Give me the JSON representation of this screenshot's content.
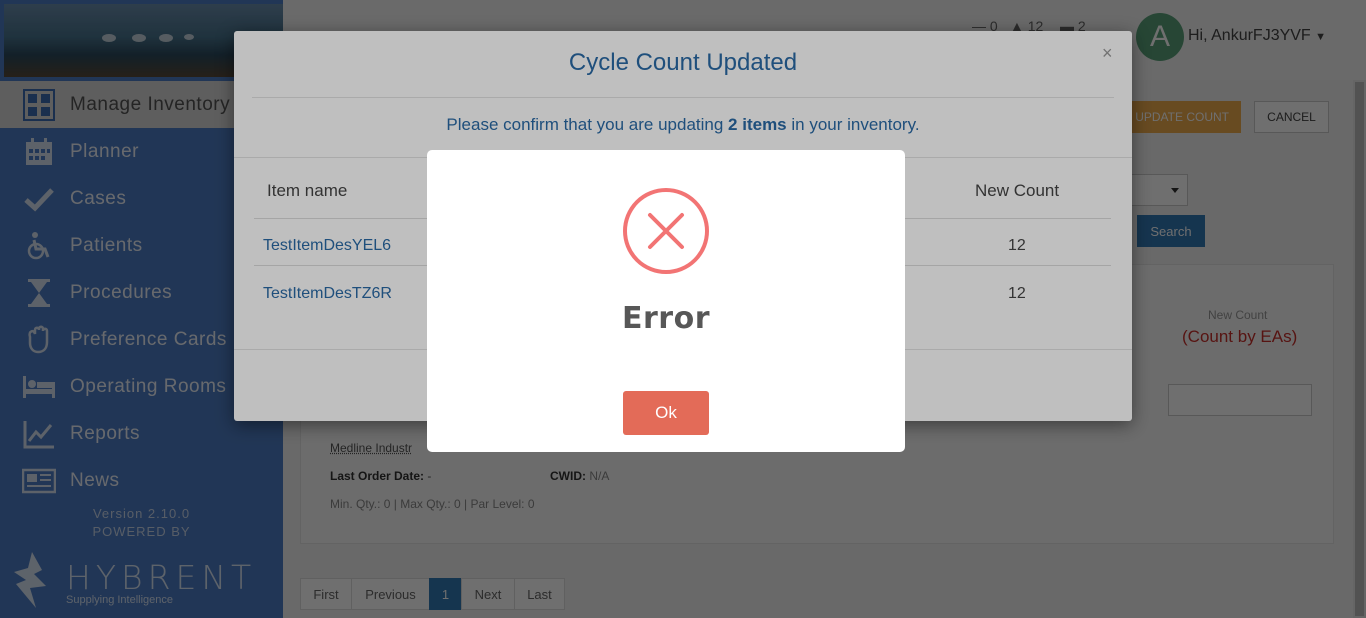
{
  "header": {
    "stat_1": "0",
    "stat_2": "12",
    "stat_3": "2",
    "avatar_letter": "A",
    "greeting": "Hi, AnkurFJ3YVF"
  },
  "sidebar": {
    "active_item": "Manage Inventory",
    "items": [
      {
        "label": "Planner",
        "icon": "calendar-icon"
      },
      {
        "label": "Cases",
        "icon": "checkmark-icon"
      },
      {
        "label": "Patients",
        "icon": "wheelchair-icon"
      },
      {
        "label": "Procedures",
        "icon": "hourglass-icon"
      },
      {
        "label": "Preference Cards",
        "icon": "glove-icon"
      },
      {
        "label": "Operating Rooms",
        "icon": "bed-icon"
      },
      {
        "label": "Reports",
        "icon": "line-chart-icon"
      },
      {
        "label": "News",
        "icon": "newspaper-icon"
      }
    ],
    "version": "Version 2.10.0",
    "powered_by": "POWERED BY",
    "brand": "HYBRENT",
    "tagline": "Supplying Intelligence"
  },
  "page": {
    "update_count_button": "UPDATE COUNT",
    "cancel_button": "CANCEL",
    "search_button": "Search",
    "new_count_header": "New Count",
    "count_by": "(Count by EAs)",
    "vendor": "Medline Industr",
    "last_order_label": "Last Order Date:",
    "last_order_value": "-",
    "cwid_label": "CWID:",
    "cwid_value": "N/A",
    "qty_info": "Min. Qty.: 0 | Max Qty.: 0 | Par Level: 0",
    "pagination": [
      "First",
      "Previous",
      "1",
      "Next",
      "Last"
    ]
  },
  "modal": {
    "title": "Cycle Count Updated",
    "confirm_prefix": "Please confirm that you are updating ",
    "confirm_bold": "2 items",
    "confirm_suffix": " in your inventory.",
    "col_item": "Item name",
    "col_new_count": "New Count",
    "rows": [
      {
        "item": "TestItemDesYEL6",
        "new_count": "12"
      },
      {
        "item": "TestItemDesTZ6R",
        "new_count": "12"
      }
    ],
    "close": "×"
  },
  "alert": {
    "title": "Error",
    "ok_button": "Ok"
  },
  "colors": {
    "sidebar": "#4f7fc7",
    "link": "#2a6aa6",
    "error": "#f27474",
    "ok_button": "#e36b58"
  }
}
